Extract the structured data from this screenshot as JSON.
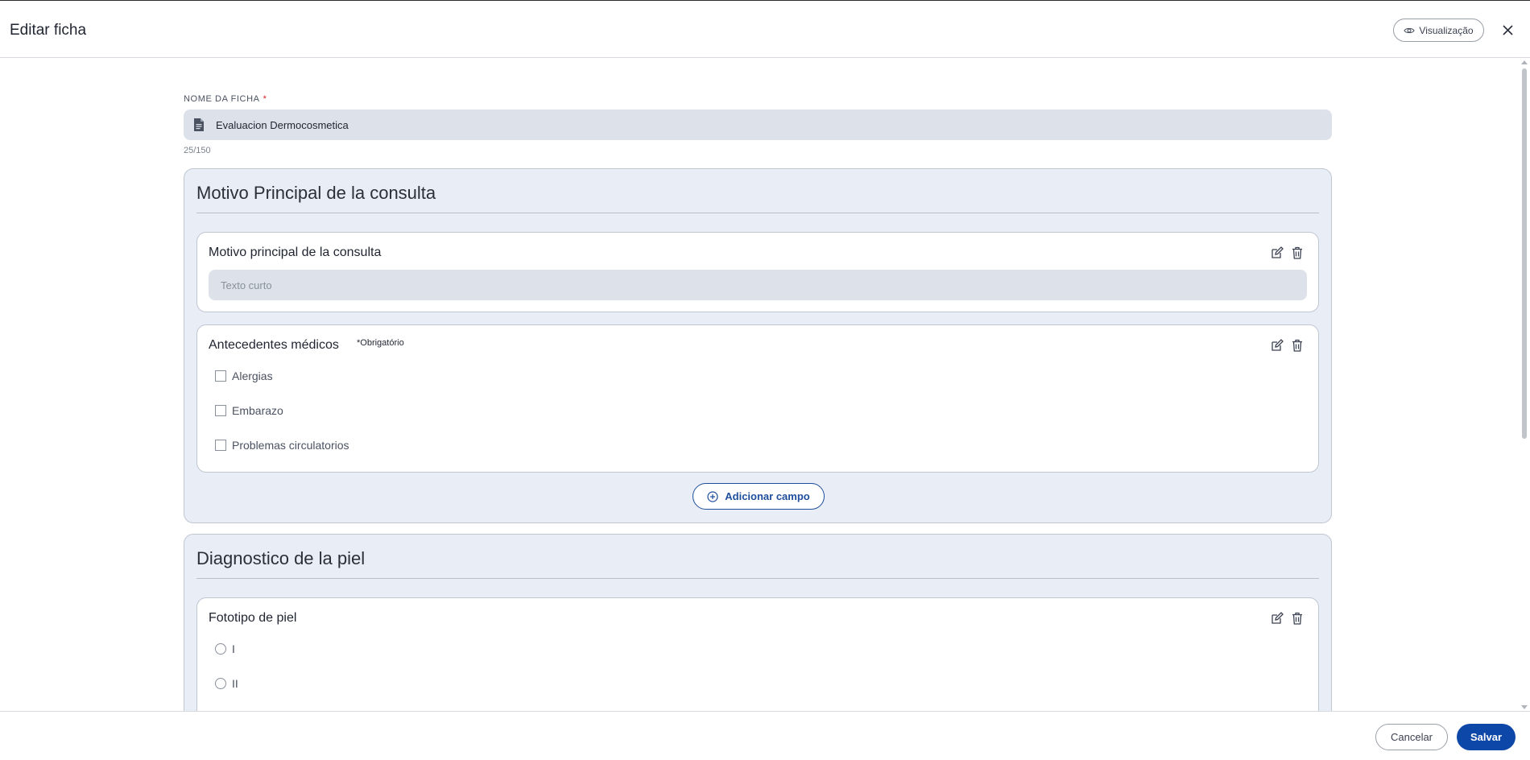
{
  "header": {
    "title": "Editar ficha",
    "preview_label": "Visualização"
  },
  "form": {
    "name_label": "NOME DA FICHA",
    "name_value": "Evaluacion Dermocosmetica",
    "char_count": "25/150"
  },
  "sections": [
    {
      "title": "Motivo Principal de la consulta",
      "fields": [
        {
          "label": "Motivo principal de la consulta",
          "type": "short-text",
          "placeholder": "Texto curto"
        },
        {
          "label": "Antecedentes médicos",
          "required_tag": "*Obrigatório",
          "type": "checkbox",
          "options": [
            "Alergias",
            "Embarazo",
            "Problemas circulatorios"
          ]
        }
      ],
      "add_field_label": "Adicionar campo"
    },
    {
      "title": "Diagnostico de la piel",
      "fields": [
        {
          "label": "Fototipo de piel",
          "type": "radio",
          "options": [
            "I",
            "II"
          ]
        }
      ]
    }
  ],
  "footer": {
    "cancel_label": "Cancelar",
    "save_label": "Salvar"
  },
  "colors": {
    "primary": "#0d47a8",
    "section_bg": "#e9eef6",
    "input_bg": "#dde2ea",
    "required": "#d11f1f"
  },
  "icons": [
    "eye-icon",
    "close-icon",
    "document-icon",
    "edit-icon",
    "trash-icon",
    "plus-circle-icon"
  ]
}
